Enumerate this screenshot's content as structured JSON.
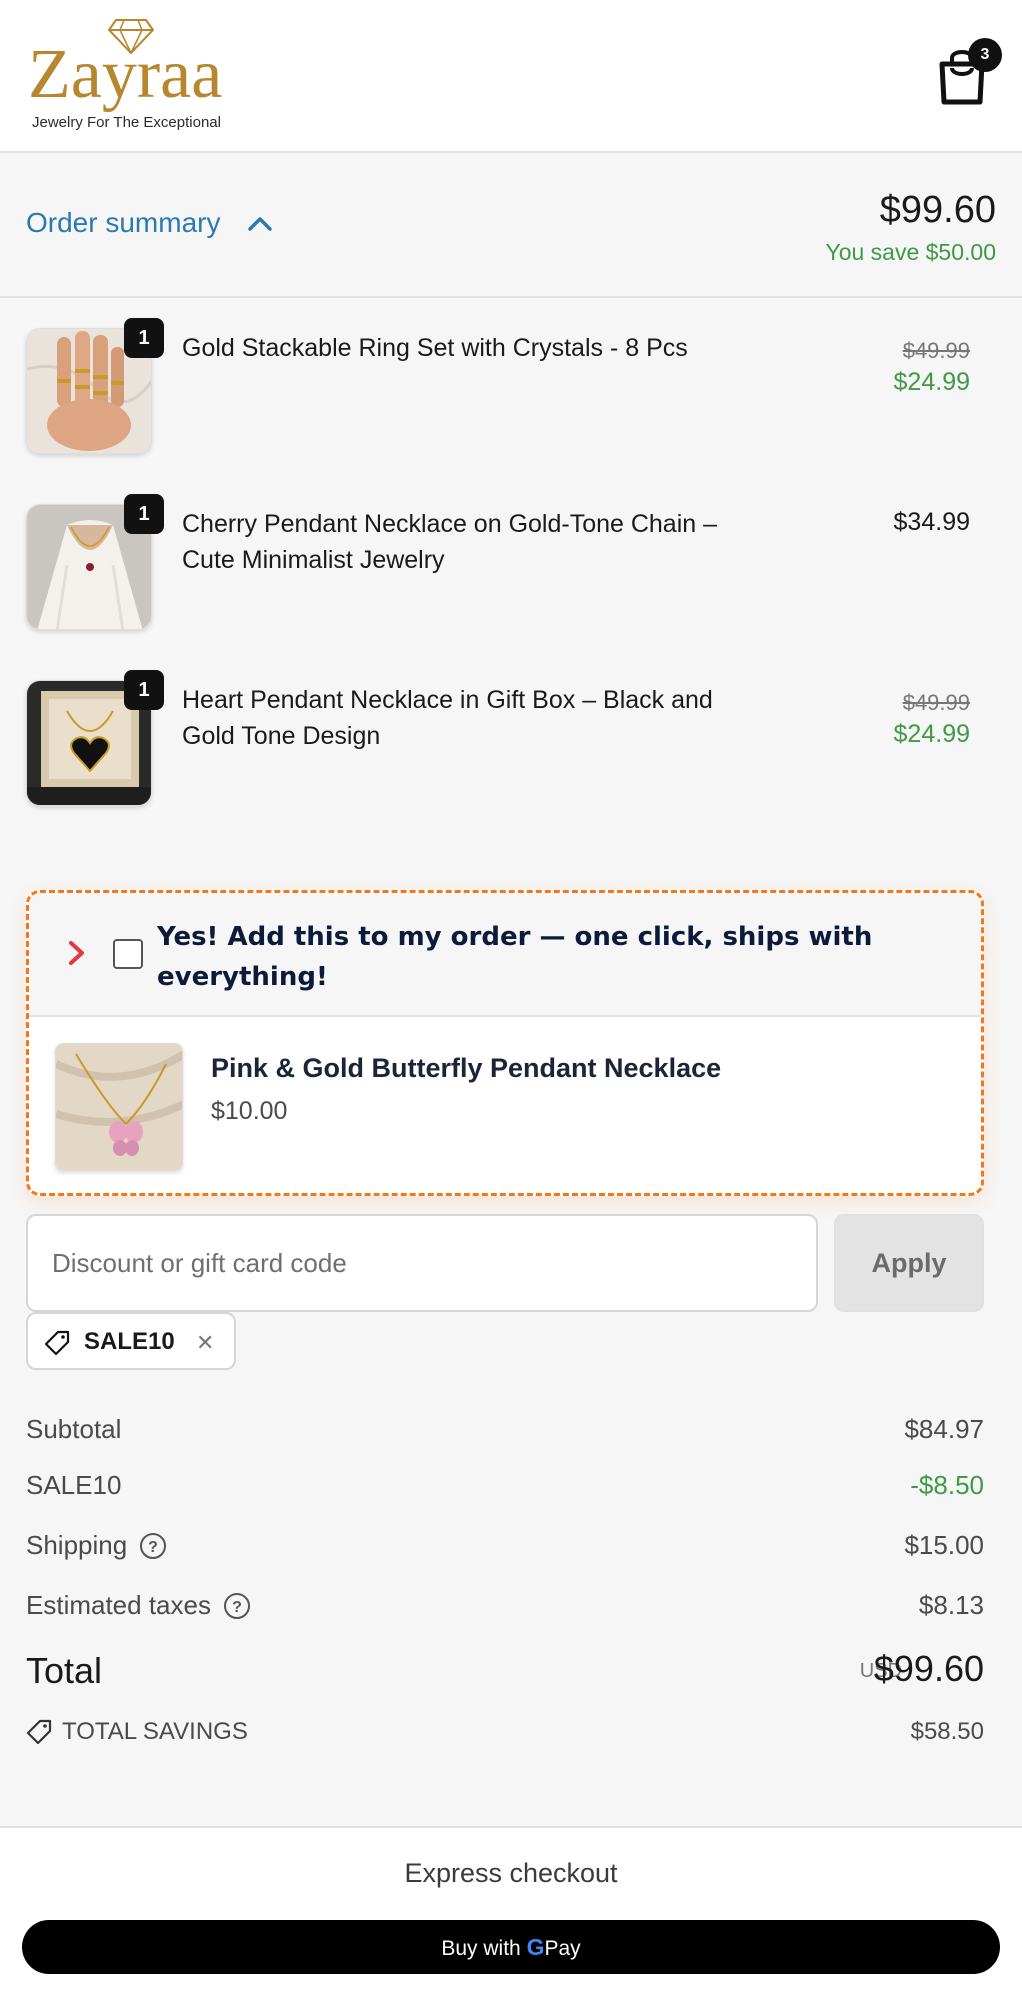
{
  "header": {
    "brand": "Zayraa",
    "tagline": "Jewelry For The Exceptional",
    "cart_count": "3"
  },
  "summary": {
    "toggle_label": "Order summary",
    "total": "$99.60",
    "savings_line": "You save $50.00"
  },
  "items": [
    {
      "qty": "1",
      "title": "Gold Stackable Ring Set with Crystals - 8 Pcs",
      "price_old": "$49.99",
      "price_new": "$24.99"
    },
    {
      "qty": "1",
      "title": "Cherry Pendant Necklace on Gold-Tone Chain – Cute Minimalist Jewelry",
      "price": "$34.99"
    },
    {
      "qty": "1",
      "title": "Heart Pendant Necklace in Gift Box – Black and Gold Tone Design",
      "price_old": "$49.99",
      "price_new": "$24.99"
    }
  ],
  "upsell": {
    "headline": "Yes! Add this to my order — one click, ships with everything!",
    "product_name": "Pink & Gold Butterfly Pendant Necklace",
    "product_price": "$10.00"
  },
  "discount": {
    "placeholder": "Discount or gift card code",
    "apply_label": "Apply",
    "applied_code": "SALE10"
  },
  "totals": {
    "subtotal_label": "Subtotal",
    "subtotal_value": "$84.97",
    "code_label": "SALE10",
    "code_value": "-$8.50",
    "shipping_label": "Shipping",
    "shipping_value": "$15.00",
    "taxes_label": "Estimated taxes",
    "taxes_value": "$8.13",
    "total_label": "Total",
    "currency": "USD",
    "total_value": "$99.60",
    "savings_label": "TOTAL SAVINGS",
    "savings_value": "$58.50"
  },
  "express": {
    "title": "Express checkout",
    "gpay_prefix": "Buy with",
    "gpay_g": "G",
    "gpay_suffix": "Pay"
  },
  "colors": {
    "link": "#2a7ab0",
    "savings_green": "#3f9a45",
    "upsell_border": "#f07a1a",
    "brand_gold": "#b8862e"
  }
}
